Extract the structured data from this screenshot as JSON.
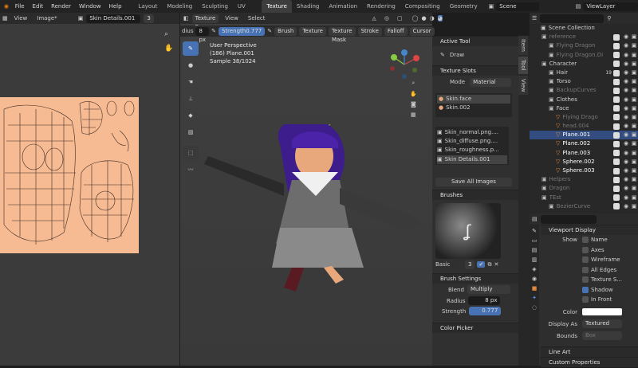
{
  "topbar": {
    "menus": [
      "File",
      "Edit",
      "Render",
      "Window",
      "Help"
    ],
    "workspaces": [
      "Layout",
      "Modeling",
      "Sculpting",
      "UV Editing",
      "Texture Paint",
      "Shading",
      "Animation",
      "Rendering",
      "Compositing",
      "Geometry"
    ],
    "active_workspace": "Texture Paint",
    "scene": "Scene",
    "view_layer": "ViewLayer"
  },
  "uv": {
    "view": "View",
    "image_menu": "Image*",
    "image_name": "Skin Details.001",
    "users": "3"
  },
  "viewport": {
    "mode": "Texture Pa...",
    "view": "View",
    "select": "Select",
    "overlay_lines": [
      "User Perspective",
      "(186) Plane.001",
      "Sample 38/1024"
    ],
    "radius_label": "dius",
    "radius_value": "8 px",
    "strength_label": "Strength",
    "strength_value": "0.777",
    "tool_menus": [
      "Brush",
      "Texture",
      "Texture Mask",
      "Stroke",
      "Falloff",
      "Cursor"
    ]
  },
  "sidebar_tabs": [
    "Item",
    "Tool",
    "View"
  ],
  "props": {
    "active_tool": "Active Tool",
    "tool_name": "Draw",
    "texture_slots": "Texture Slots",
    "mode_label": "Mode",
    "mode_value": "Material",
    "materials": [
      "Skin.face",
      "Skin.002"
    ],
    "images": [
      "Skin_normal.png....",
      "Skin_diffuse.png....",
      "Skin_roughness.p...",
      "Skin Details.001"
    ],
    "save_all": "Save All Images",
    "brushes": "Brushes",
    "brush_name": "Basic",
    "brush_users": "3",
    "brush_settings": "Brush Settings",
    "blend_label": "Blend",
    "blend_value": "Multiply",
    "radius_label": "Radius",
    "radius_value": "8 px",
    "strength_label": "Strength",
    "strength_value": "0.777",
    "color_picker": "Color Picker"
  },
  "outliner": {
    "root": "Scene Collection",
    "rows": [
      {
        "indent": 1,
        "name": "reference",
        "dim": true
      },
      {
        "indent": 2,
        "name": "Flying Dragon",
        "dim": true
      },
      {
        "indent": 2,
        "name": "Flying Dragon.Di",
        "dim": true
      },
      {
        "indent": 1,
        "name": "Character",
        "dim": false
      },
      {
        "indent": 2,
        "name": "Hair",
        "dim": false,
        "badge": "19"
      },
      {
        "indent": 2,
        "name": "Torso",
        "dim": false
      },
      {
        "indent": 2,
        "name": "BackupCurves",
        "dim": true
      },
      {
        "indent": 2,
        "name": "Clothes",
        "dim": false
      },
      {
        "indent": 2,
        "name": "Face",
        "dim": false
      },
      {
        "indent": 3,
        "name": "Flying Drago",
        "dim": true
      },
      {
        "indent": 3,
        "name": "head.004",
        "dim": true
      },
      {
        "indent": 3,
        "name": "Plane.001",
        "dim": false,
        "selected": true
      },
      {
        "indent": 3,
        "name": "Plane.002",
        "dim": false
      },
      {
        "indent": 3,
        "name": "Plane.003",
        "dim": false
      },
      {
        "indent": 3,
        "name": "Sphere.002",
        "dim": false
      },
      {
        "indent": 3,
        "name": "Sphere.003",
        "dim": false
      },
      {
        "indent": 1,
        "name": "Helpers",
        "dim": true
      },
      {
        "indent": 1,
        "name": "Dragon",
        "dim": true
      },
      {
        "indent": 1,
        "name": "TEst",
        "dim": true
      },
      {
        "indent": 2,
        "name": "BezierCurve",
        "dim": true
      }
    ]
  },
  "objprops": {
    "section": "Viewport Display",
    "show_label": "Show",
    "options": [
      {
        "label": "Name",
        "on": false
      },
      {
        "label": "Axes",
        "on": false
      },
      {
        "label": "Wireframe",
        "on": false
      },
      {
        "label": "All Edges",
        "on": false
      },
      {
        "label": "Texture S...",
        "on": false
      },
      {
        "label": "Shadow",
        "on": true
      },
      {
        "label": "In Front",
        "on": false
      }
    ],
    "color_label": "Color",
    "display_as_label": "Display As",
    "display_as_value": "Textured",
    "bounds_label": "Bounds",
    "bounds_value": "Box",
    "line_art": "Line Art",
    "custom_properties": "Custom Properties"
  }
}
